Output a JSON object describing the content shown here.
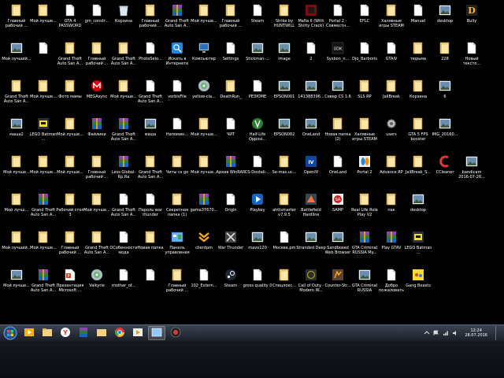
{
  "desktop": {
    "rows": [
      [
        {
          "label": "Главный рабочий ...",
          "icon": "folder"
        },
        {
          "label": "Мой лучше...",
          "icon": "folder"
        },
        {
          "label": "GTA 4 PASSWORD",
          "icon": "doc"
        },
        {
          "label": "gm_constr...",
          "icon": "doc"
        },
        {
          "label": "Корзина",
          "icon": "recycle"
        },
        {
          "label": "Главный рабочий ...",
          "icon": "folder"
        },
        {
          "label": "Grand Theft Auto San A...",
          "icon": "winrar"
        },
        {
          "label": "Мой лучше...",
          "icon": "folder"
        },
        {
          "label": "Главный рабочий ...",
          "icon": "folder"
        },
        {
          "label": "Steam",
          "icon": "doc"
        },
        {
          "label": "Strike by HUNTWILL",
          "icon": "folder"
        },
        {
          "label": "Mafia II (With Shitty Crack)",
          "icon": "mafia"
        },
        {
          "label": "Portal 2 - Совместн...",
          "icon": "doc"
        },
        {
          "label": "EFLC",
          "icon": "doc"
        },
        {
          "label": "Халявные игры STEAM",
          "icon": "folder"
        },
        {
          "label": "Manuel",
          "icon": "doc"
        },
        {
          "label": "desktop",
          "icon": "image"
        },
        {
          "label": "Bully",
          "icon": "bully"
        }
      ],
      [
        {
          "label": "Мой лучший...",
          "icon": "image"
        },
        {
          "label": "",
          "icon": "doc"
        },
        {
          "label": "Grand Theft Auto San A...",
          "icon": "folder"
        },
        {
          "label": "Главный рабочий ...",
          "icon": "folder"
        },
        {
          "label": "Grand Theft Auto San A...",
          "icon": "folder"
        },
        {
          "label": "PhotoSelo...",
          "icon": "doc"
        },
        {
          "label": "Искать в Интернете",
          "icon": "search"
        },
        {
          "label": "Компьютер",
          "icon": "computer"
        },
        {
          "label": "Settings",
          "icon": "doc"
        },
        {
          "label": "Stickman-...",
          "icon": "image"
        },
        {
          "label": "image",
          "icon": "image"
        },
        {
          "label": "2",
          "icon": "doc"
        },
        {
          "label": "Sysbon_n...",
          "icon": "udk"
        },
        {
          "label": "Djo_Barboris",
          "icon": "doc"
        },
        {
          "label": "GTAIV",
          "icon": "doc"
        },
        {
          "label": "тюрьма",
          "icon": "folder"
        },
        {
          "label": "228",
          "icon": "folder"
        },
        {
          "label": "Новый тексто...",
          "icon": "doc"
        }
      ],
      [
        {
          "label": "Grand Theft Auto San A...",
          "icon": "folder"
        },
        {
          "label": "Мой лучше...",
          "icon": "folder"
        },
        {
          "label": "Фото мамы",
          "icon": "folder"
        },
        {
          "label": "MEGAsync",
          "icon": "mega"
        },
        {
          "label": "Мой лучше...",
          "icon": "folder"
        },
        {
          "label": "Grand Theft Auto San A...",
          "icon": "doc"
        },
        {
          "label": "vorbisFile",
          "icon": "doc"
        },
        {
          "label": "yellow-cla...",
          "icon": "disc"
        },
        {
          "label": "DeathRun_",
          "icon": "folder"
        },
        {
          "label": "РЕЗЮМЕ",
          "icon": "doc"
        },
        {
          "label": "EPSON001",
          "icon": "image"
        },
        {
          "label": "141388396...",
          "icon": "image"
        },
        {
          "label": "Север CS 1.6",
          "icon": "image"
        },
        {
          "label": "SLS RP",
          "icon": "folder"
        },
        {
          "label": "JailBreak",
          "icon": "folder"
        },
        {
          "label": "Корзина",
          "icon": "folder"
        },
        {
          "label": "6",
          "icon": "image"
        }
      ],
      [
        {
          "label": "маша2",
          "icon": "image"
        },
        {
          "label": "LEGO Batman ...",
          "icon": "lego"
        },
        {
          "label": "Мой лучше...",
          "icon": "folder"
        },
        {
          "label": "Файлики",
          "icon": "winrar"
        },
        {
          "label": "Grand Theft Auto San A...",
          "icon": "winrar"
        },
        {
          "label": "маша",
          "icon": "image"
        },
        {
          "label": "Напомин...",
          "icon": "doc"
        },
        {
          "label": "Мой лучше...",
          "icon": "folder"
        },
        {
          "label": "ЧИТ",
          "icon": "doc"
        },
        {
          "label": "Half-Life Opposi...",
          "icon": "halflife"
        },
        {
          "label": "EPSON002",
          "icon": "image"
        },
        {
          "label": "OneLand",
          "icon": "image"
        },
        {
          "label": "Новая папка (2)",
          "icon": "folder"
        },
        {
          "label": "Халявные игры STEAM",
          "icon": "folder"
        },
        {
          "label": "users",
          "icon": "gear"
        },
        {
          "label": "GTA 5 FPS booster",
          "icon": "folder"
        },
        {
          "label": "IMG_20160...",
          "icon": "image"
        }
      ],
      [
        {
          "label": "Мой лучше...",
          "icon": "folder"
        },
        {
          "label": "Мой лучше...",
          "icon": "folder"
        },
        {
          "label": "Мой лучше...",
          "icon": "folder"
        },
        {
          "label": "Главный рабочий ...",
          "icon": "folder"
        },
        {
          "label": "Less Global-Rp.Ra",
          "icon": "winrar"
        },
        {
          "label": "Grand Theft Auto San A...",
          "icon": "folder"
        },
        {
          "label": "Читы cs go",
          "icon": "folder"
        },
        {
          "label": "Мой лучше...",
          "icon": "folder"
        },
        {
          "label": "Архив WinRAR",
          "icon": "winrar"
        },
        {
          "label": "CS-Dostali-...",
          "icon": "doc"
        },
        {
          "label": "Se-mas.uc...",
          "icon": "folder"
        },
        {
          "label": "OpenIV",
          "icon": "openiv"
        },
        {
          "label": "OneLand",
          "icon": "doc"
        },
        {
          "label": "Portal 2",
          "icon": "portal"
        },
        {
          "label": "Advance RP",
          "icon": "folder"
        },
        {
          "label": "JailBreak_S...",
          "icon": "folder"
        },
        {
          "label": "CCleaner",
          "icon": "ccleaner"
        },
        {
          "label": "bandicam 2016-07-26...",
          "icon": "image"
        }
      ],
      [
        {
          "label": "Мой лучш...",
          "icon": "folder"
        },
        {
          "label": "Grand Theft Auto San A...",
          "icon": "winrar"
        },
        {
          "label": "Рабочий стол 3",
          "icon": "folder"
        },
        {
          "label": "Мой лучше...",
          "icon": "folder"
        },
        {
          "label": "Grand Theft Auto San A...",
          "icon": "doc"
        },
        {
          "label": "Пароль war thunder",
          "icon": "doc"
        },
        {
          "label": "Секретная папка (1)",
          "icon": "folder"
        },
        {
          "label": "gama37670...",
          "icon": "winrar"
        },
        {
          "label": "Origin",
          "icon": "doc"
        },
        {
          "label": "Playkey",
          "icon": "playkey"
        },
        {
          "label": "ahttsmarter v7.9.5",
          "icon": "folder"
        },
        {
          "label": "Battlefield Hardline",
          "icon": "battlefield"
        },
        {
          "label": "SAMP",
          "icon": "samp"
        },
        {
          "label": "Real Life Role Play V2",
          "icon": "folder"
        },
        {
          "label": "пак",
          "icon": "folder"
        },
        {
          "label": "desktop",
          "icon": "image"
        }
      ],
      [
        {
          "label": "Мой лучший...",
          "icon": "folder"
        },
        {
          "label": "Мой лучше...",
          "icon": "folder"
        },
        {
          "label": "Главный рабочий ...",
          "icon": "folder"
        },
        {
          "label": "Grand Theft Auto San A...",
          "icon": "folder"
        },
        {
          "label": "ОСобенности мода",
          "icon": "doc"
        },
        {
          "label": "Новая папка",
          "icon": "folder"
        },
        {
          "label": "Панель управления",
          "icon": "controlpanel"
        },
        {
          "label": "clientpm",
          "icon": "clientpm"
        },
        {
          "label": "War Thunder",
          "icon": "warthunder"
        },
        {
          "label": "mavo120",
          "icon": "image"
        },
        {
          "label": "Москва.pm",
          "icon": "doc"
        },
        {
          "label": "Stranded Deep",
          "icon": "image"
        },
        {
          "label": "Sandboxed Web Browser",
          "icon": "image"
        },
        {
          "label": "GTA Criminal RUSSIA My...",
          "icon": "winrar"
        },
        {
          "label": "Play GTAV",
          "icon": "winrar"
        },
        {
          "label": "LEGO Batman ...",
          "icon": "lego"
        }
      ],
      [
        {
          "label": "Мой лучше...",
          "icon": "image"
        },
        {
          "label": "Grand Theft Auto San A...",
          "icon": "winrar"
        },
        {
          "label": "Презентация Microsoft ...",
          "icon": "ppt"
        },
        {
          "label": "Valkyrie",
          "icon": "disc"
        },
        {
          "label": "mother_of...",
          "icon": "doc"
        },
        {
          "label": "",
          "icon": "doc"
        },
        {
          "label": "Главный рабочий ...",
          "icon": "folder"
        },
        {
          "label": "102_Extern...",
          "icon": "doc"
        },
        {
          "label": "Steam",
          "icon": "steam"
        },
        {
          "label": "gross quality 0",
          "icon": "doc"
        },
        {
          "label": "Спецлокс...",
          "icon": "folder"
        },
        {
          "label": "Call of Duty - Modern W...",
          "icon": "cod"
        },
        {
          "label": "Counter-Str...",
          "icon": "cs"
        },
        {
          "label": "GTA Criminal RUSSIA",
          "icon": "image"
        },
        {
          "label": "Добро пожаловать",
          "icon": "doc"
        },
        {
          "label": "Gang Beasts",
          "icon": "gangbeasts"
        }
      ]
    ]
  },
  "taskbar": {
    "apps": [
      {
        "name": "start-button"
      },
      {
        "name": "media-player",
        "icon": "media"
      },
      {
        "name": "explorer",
        "icon": "explorer"
      },
      {
        "name": "yandex-browser",
        "icon": "yandex"
      },
      {
        "name": "winrar",
        "icon": "winrar"
      },
      {
        "name": "folder",
        "icon": "folder"
      },
      {
        "name": "chrome",
        "icon": "chrome"
      },
      {
        "name": "media-player-2",
        "icon": "mediabox"
      },
      {
        "name": "window",
        "icon": "window"
      },
      {
        "name": "record",
        "icon": "record"
      }
    ],
    "clock_time": "12:24",
    "clock_date": "28.07.2016"
  }
}
